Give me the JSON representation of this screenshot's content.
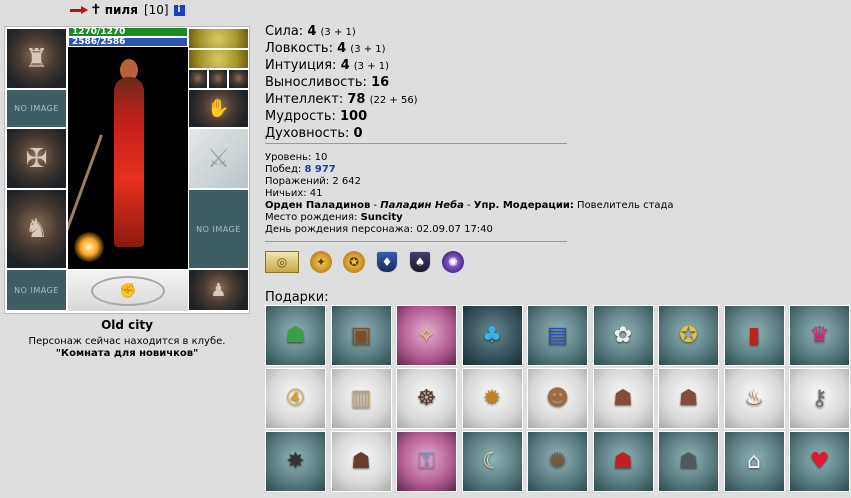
{
  "header": {
    "name": "пиля",
    "level": "[10]",
    "info_icon": "i"
  },
  "bars": {
    "hp": "1270/1270",
    "mana": "2586/2586",
    "hp_color": "#1d8a25",
    "mana_color": "#2a55b5"
  },
  "slots": {
    "no_image": "NO IMAGE"
  },
  "location": {
    "title": "Old city",
    "line1": "Персонаж сейчас находится в клубе.",
    "line2": "\"Комната для новичков\""
  },
  "stats": [
    {
      "label": "Сила:",
      "value": "4",
      "extra": "(3 + 1)"
    },
    {
      "label": "Ловкость:",
      "value": "4",
      "extra": "(3 + 1)"
    },
    {
      "label": "Интуиция:",
      "value": "4",
      "extra": "(3 + 1)"
    },
    {
      "label": "Выносливость:",
      "value": "16",
      "extra": ""
    },
    {
      "label": "Интеллект:",
      "value": "78",
      "extra": "(22 + 56)"
    },
    {
      "label": "Мудрость:",
      "value": "100",
      "extra": ""
    },
    {
      "label": "Духовность:",
      "value": "0",
      "extra": ""
    }
  ],
  "info": {
    "level_label": "Уровень:",
    "level_value": "10",
    "wins_label": "Побед:",
    "wins_value": "8 977",
    "losses_label": "Поражений:",
    "losses_value": "2 642",
    "draws_label": "Ничьих:",
    "draws_value": "41",
    "order": "Орден Паладинов",
    "order_rank": "Паладин Неба",
    "department": "Упр. Модерации:",
    "department_title": "Повелитель стада",
    "birthplace_label": "Место рождения:",
    "birthplace_value": "Suncity",
    "birthday_label": "День рождения персонажа:",
    "birthday_value": "02.09.07 17:40"
  },
  "gifts_title": "Подарки:",
  "gifts": [
    "green-cloak-icon",
    "treasure-chest-icon",
    "magic-staff-icon",
    "blue-mushroom-icon",
    "spellbook-icon",
    "flower-bouquet-icon",
    "gold-shield-icon",
    "red-book-icon",
    "jester-hat-icon",
    "gold-medal-4-icon",
    "scroll-icon",
    "spider-icon",
    "medal-icon",
    "teddy-bear-icon",
    "robot-a-icon",
    "robot-b-icon",
    "beer-mug-icon",
    "keychain-icon",
    "mace-icon",
    "armored-bot-icon",
    "keyring-icon",
    "fang-icon",
    "hedgehog-icon",
    "red-cloak-icon",
    "grey-cloak-icon",
    "snow-house-icon",
    "heart-icon"
  ]
}
